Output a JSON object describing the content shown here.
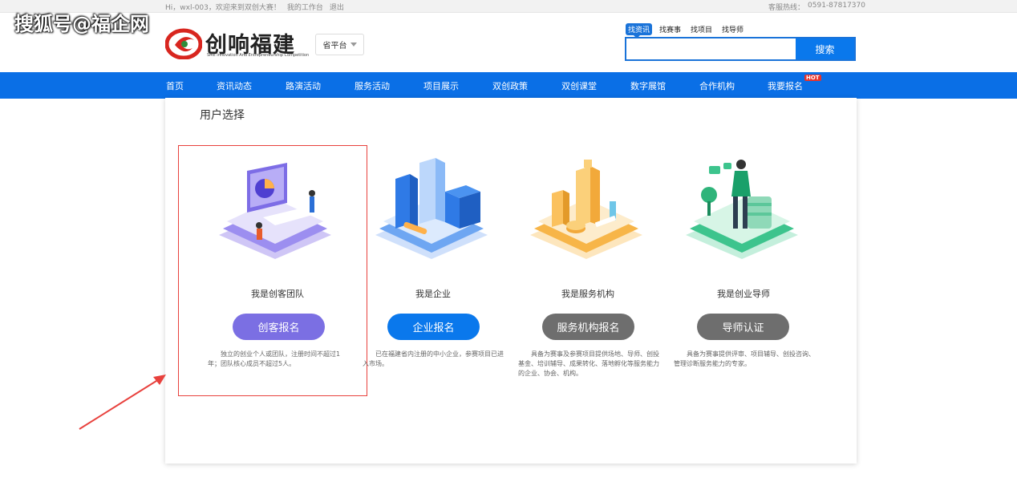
{
  "topbar": {
    "greeting": "Hi，wxl-003，欢迎来到双创大赛！",
    "workbench": "我的工作台",
    "logout": "退出",
    "hotline_label": "客服热线：",
    "hotline": "0591-87817370"
  },
  "watermark": "搜狐号@福企网",
  "logo": {
    "name": "创响福建",
    "subtitle": "SME Innovation And Entrepreneurship Competition"
  },
  "platform_select": {
    "value": "省平台"
  },
  "search": {
    "tabs": [
      {
        "label": "找资讯"
      },
      {
        "label": "找赛事"
      },
      {
        "label": "找项目"
      },
      {
        "label": "找导师"
      }
    ],
    "value": "",
    "button": "搜索"
  },
  "nav": {
    "items": [
      {
        "label": "首页"
      },
      {
        "label": "资讯动态"
      },
      {
        "label": "路演活动"
      },
      {
        "label": "服务活动"
      },
      {
        "label": "项目展示"
      },
      {
        "label": "双创政策"
      },
      {
        "label": "双创课堂"
      },
      {
        "label": "数字展馆"
      },
      {
        "label": "合作机构"
      },
      {
        "label": "我要报名"
      }
    ],
    "hot_badge": "HOT"
  },
  "section_title": "用户选择",
  "roles": [
    {
      "label": "我是创客团队",
      "button": "创客报名",
      "color": "#7b6fe3",
      "desc": "独立的创业个人或团队，注册时间不超过1年；团队核心成员不超过5人。"
    },
    {
      "label": "我是企业",
      "button": "企业报名",
      "color": "#0a78ec",
      "desc": "已在福建省内注册的中小企业，参赛项目已进入市场。"
    },
    {
      "label": "我是服务机构",
      "button": "服务机构报名",
      "color": "#6e6e6e",
      "desc": "具备为赛事及参赛项目提供场地、导师、创投基金、培训辅导、成果转化、落地孵化等服务能力的企业、协会、机构。"
    },
    {
      "label": "我是创业导师",
      "button": "导师认证",
      "color": "#6e6e6e",
      "desc": "具备为赛事提供评审、项目辅导、创投咨询、管理诊断服务能力的专家。"
    }
  ]
}
